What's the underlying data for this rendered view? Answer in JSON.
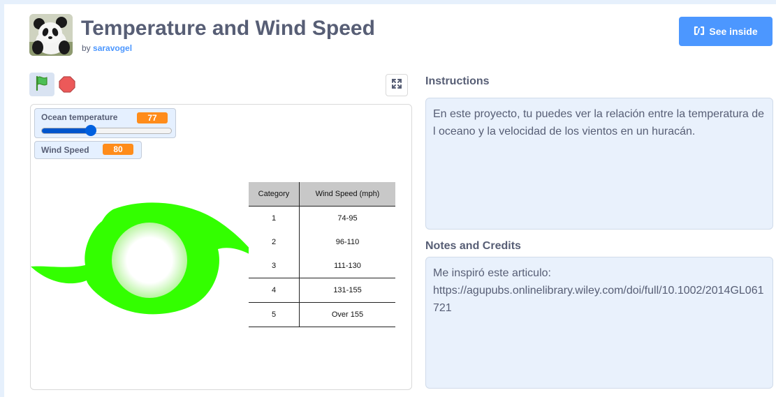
{
  "project": {
    "title": "Temperature and Wind Speed",
    "by_label": "by",
    "author": "saravogel",
    "avatar_icon": "panda-icon"
  },
  "header": {
    "see_inside_label": "See inside",
    "see_inside_icon": "remix-icon",
    "accent_color": "#4c97ff"
  },
  "controls": {
    "green_flag_icon": "green-flag-icon",
    "stop_icon": "stop-sign-icon",
    "fullscreen_icon": "fullscreen-icon"
  },
  "stage": {
    "monitors": {
      "ocean_temperature": {
        "label": "Ocean temperature",
        "value": "77",
        "slider_fraction": 0.38
      },
      "wind_speed": {
        "label": "Wind Speed",
        "value": "80"
      }
    },
    "hurricane": {
      "color": "#33ff00",
      "icon": "hurricane-symbol"
    },
    "category_table": {
      "headers": [
        "Category",
        "Wind Speed (mph)"
      ],
      "rows": [
        [
          "1",
          "74-95"
        ],
        [
          "2",
          "96-110"
        ],
        [
          "3",
          "111-130"
        ],
        [
          "4",
          "131-155"
        ],
        [
          "5",
          "Over 155"
        ]
      ]
    }
  },
  "instructions": {
    "title": "Instructions",
    "text": "En este proyecto, tu puedes ver la relación entre la temperatura del oceano y la velocidad de los vientos en un huracán."
  },
  "notes": {
    "title": "Notes and Credits",
    "line1": "Me inspiró este articulo:",
    "line2": "https://agupubs.onlinelibrary.wiley.com/doi/full/10.1002/2014GL061721"
  }
}
